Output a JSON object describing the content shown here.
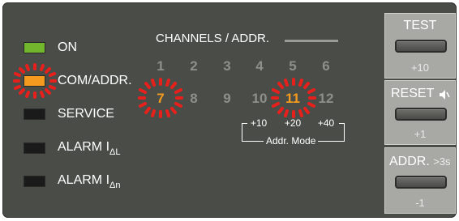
{
  "legend": [
    {
      "label": "ON",
      "color": "#71b62c",
      "blink": false
    },
    {
      "label": "COM/ADDR.",
      "color": "#f49a1e",
      "blink": true
    },
    {
      "label": "SERVICE",
      "color": "#1a1a1a",
      "blink": false
    },
    {
      "label_main": "ALARM I",
      "label_sub": "ΔL",
      "color": "#1a1a1a",
      "blink": false
    },
    {
      "label_main": "ALARM I",
      "label_sub": "Δn",
      "color": "#1a1a1a",
      "blink": false
    }
  ],
  "channels": {
    "title": "CHANNELS / ADDR.",
    "row1": [
      "1",
      "2",
      "3",
      "4",
      "5",
      "6"
    ],
    "row2": [
      "7",
      "8",
      "9",
      "10",
      "11",
      "12"
    ],
    "active": [
      "7",
      "11"
    ],
    "addr_values": [
      "+10",
      "+20",
      "+40"
    ],
    "addr_mode_label": "Addr. Mode"
  },
  "buttons": {
    "test": {
      "label": "TEST",
      "value": "+10"
    },
    "reset": {
      "label": "RESET",
      "value": "+1",
      "icon": "speaker-mute-icon"
    },
    "addr": {
      "label": "ADDR.",
      "hint": ">3s",
      "value": "-1"
    }
  },
  "colors": {
    "panel": "#4a4c48",
    "button_panel": "#a8a9a5",
    "active_channel": "#f49a1e",
    "blink_halo": "#e8201c"
  }
}
